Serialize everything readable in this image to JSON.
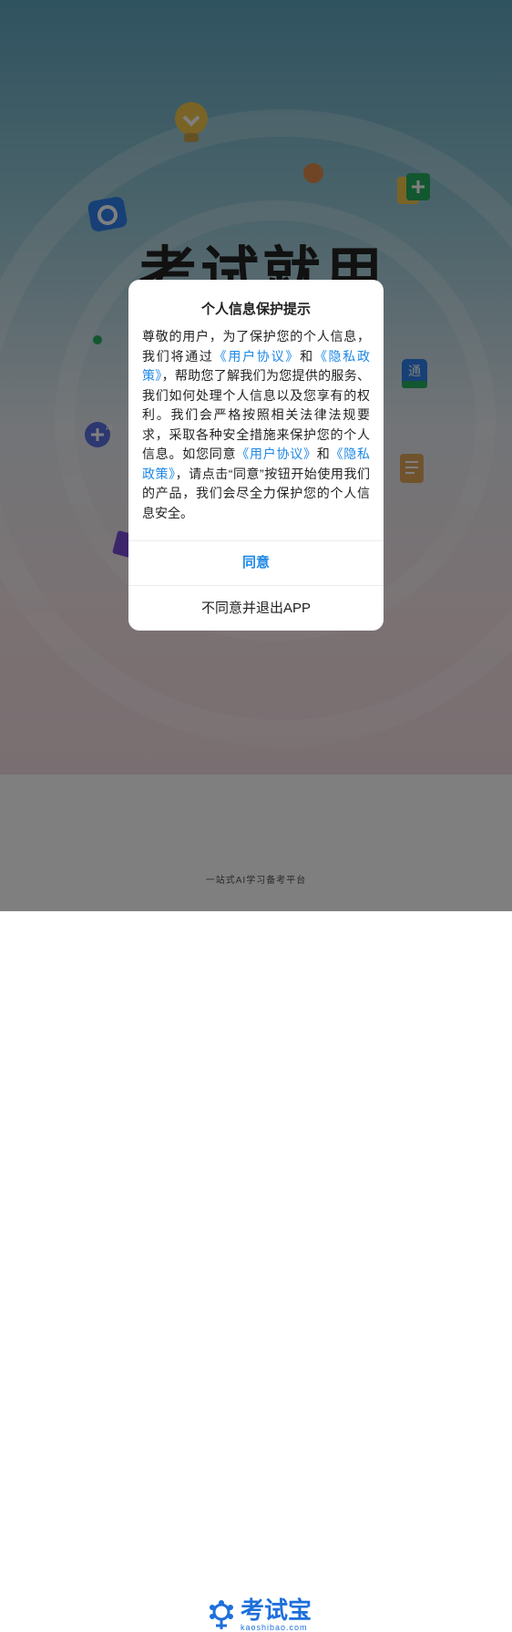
{
  "splash": {
    "hero_title": "考试就用"
  },
  "footer": {
    "brand_name": "考试宝",
    "brand_domain": "kaoshibao.com",
    "slogan": "一站式AI学习备考平台"
  },
  "dialog": {
    "title": "个人信息保护提示",
    "body": {
      "p1": "尊敬的用户，为了保护您的个人信息，我们将通过",
      "link_user_agreement": "《用户协议》",
      "and1": "和",
      "link_privacy_policy": "《隐私政策》",
      "p2": "，帮助您了解我们为您提供的服务、我们如何处理个人信息以及您享有的权利。我们会严格按照相关法律法规要求，采取各种安全措施来保护您的个人信息。如您同意",
      "link_user_agreement_2": "《用户协议》",
      "and2": "和",
      "link_privacy_policy_2": "《隐私政策》",
      "p3": "，请点击“同意”按钮开始使用我们的产品，我们会尽全力保护您的个人信息安全。"
    },
    "agree_label": "同意",
    "disagree_label": "不同意并退出APP"
  },
  "icons": [
    "lightbulb-icon",
    "camera-icon",
    "book-plus-icon",
    "ai-plus-icon",
    "translate-book-icon",
    "ai-scroll-icon",
    "brand-logo-icon"
  ],
  "colors": {
    "link": "#1e88e5",
    "brand": "#1e6fdc",
    "mask": "rgba(0,0,0,0.5)"
  }
}
